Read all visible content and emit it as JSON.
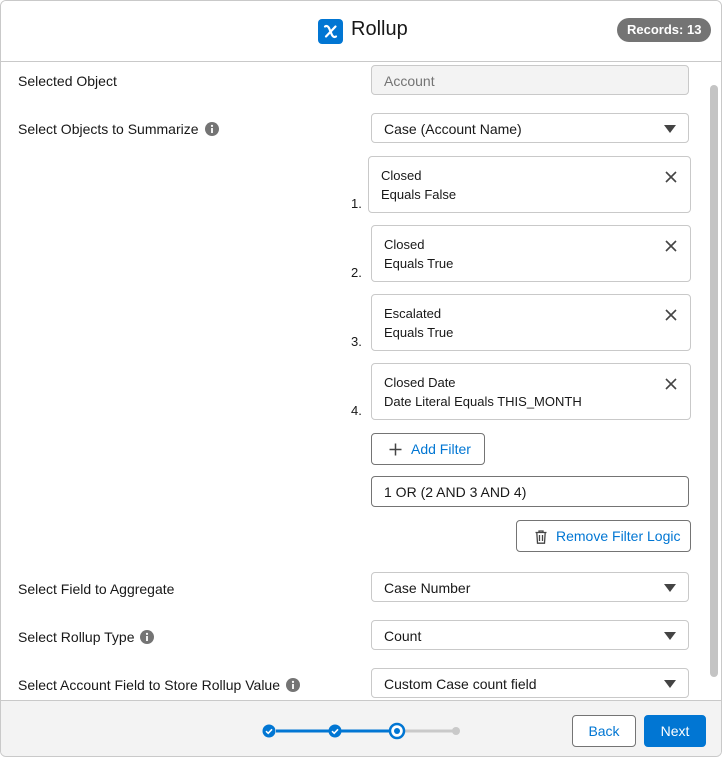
{
  "header": {
    "title": "Rollup",
    "records_badge": "Records: 13",
    "app_icon": "rollup-x-icon",
    "accent_color": "#0176d3"
  },
  "form": {
    "selected_object": {
      "label": "Selected Object",
      "value": "Account"
    },
    "objects_to_summarize": {
      "label": "Select Objects to Summarize",
      "value": "Case (Account Name)"
    },
    "filters": [
      {
        "number": "1.",
        "field": "Closed",
        "condition": "Equals False"
      },
      {
        "number": "2.",
        "field": "Closed",
        "condition": "Equals True"
      },
      {
        "number": "3.",
        "field": "Escalated",
        "condition": "Equals True"
      },
      {
        "number": "4.",
        "field": "Closed Date",
        "condition": "Date Literal Equals THIS_MONTH"
      }
    ],
    "add_filter_label": "Add Filter",
    "filter_logic_value": "1 OR (2 AND 3 AND 4)",
    "remove_filter_logic_label": "Remove Filter Logic",
    "field_to_aggregate": {
      "label": "Select Field to Aggregate",
      "value": "Case Number"
    },
    "rollup_type": {
      "label": "Select Rollup Type",
      "value": "Count"
    },
    "store_field": {
      "label": "Select Account Field to Store Rollup Value",
      "value": "Custom Case count field"
    }
  },
  "footer": {
    "back_label": "Back",
    "next_label": "Next",
    "progress": {
      "total_steps": 4,
      "completed_steps": 2,
      "current_step": 3
    }
  }
}
